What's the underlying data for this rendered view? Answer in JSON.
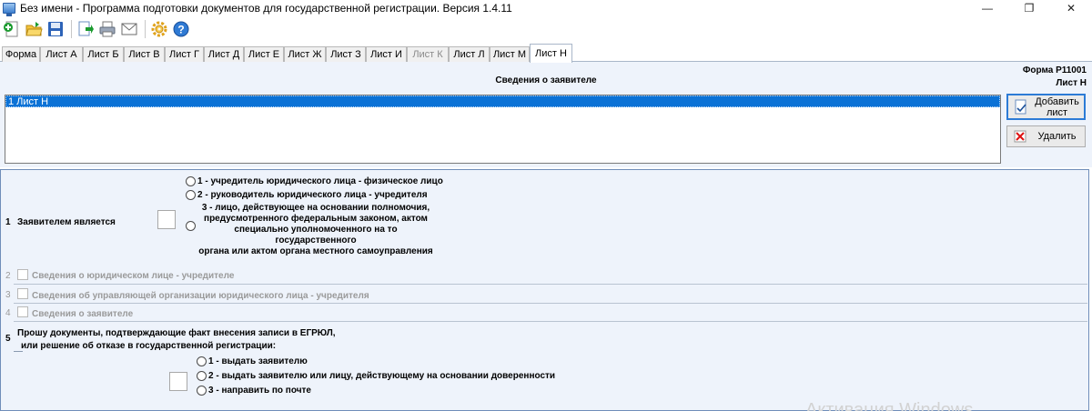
{
  "window": {
    "title": "Без имени - Программа подготовки документов для государственной регистрации. Версия 1.4.11",
    "minimize": "—",
    "maximize": "❐",
    "close": "✕"
  },
  "toolbar": {
    "icons": [
      "new-doc-icon",
      "open-folder-icon",
      "save-disk-icon",
      "export-icon",
      "print-icon",
      "mail-icon",
      "settings-gear-icon",
      "help-icon"
    ]
  },
  "tabs": [
    {
      "label": "Форма",
      "state": "normal"
    },
    {
      "label": "Лист А",
      "state": "normal"
    },
    {
      "label": "Лист Б",
      "state": "normal"
    },
    {
      "label": "Лист В",
      "state": "normal"
    },
    {
      "label": "Лист Г",
      "state": "normal"
    },
    {
      "label": "Лист Д",
      "state": "normal"
    },
    {
      "label": "Лист Е",
      "state": "normal"
    },
    {
      "label": "Лист Ж",
      "state": "normal"
    },
    {
      "label": "Лист З",
      "state": "normal"
    },
    {
      "label": "Лист И",
      "state": "normal"
    },
    {
      "label": "Лист К",
      "state": "disabled"
    },
    {
      "label": "Лист Л",
      "state": "normal"
    },
    {
      "label": "Лист М",
      "state": "normal"
    },
    {
      "label": "Лист Н",
      "state": "active"
    }
  ],
  "form": {
    "form_name": "Форма Р11001",
    "sheet_name": "Лист Н",
    "section_title": "Сведения о заявителе",
    "list_items": [
      "1 Лист Н"
    ],
    "add_button": "Добавить лист",
    "delete_button": "Удалить"
  },
  "section1": {
    "number": "1",
    "label": "Заявителем является",
    "opt1": "1 - учредитель юридического лица - физическое лицо",
    "opt2": "2 - руководитель юридического лица - учредителя",
    "opt3_line1": "3 - лицо, действующее на основании полномочия,",
    "opt3_line2": "предусмотренного федеральным законом, актом",
    "opt3_line3": "специально уполномоченного на то государственного",
    "opt3_line4": "органа или актом органа местного самоуправления"
  },
  "section2": {
    "number": "2",
    "label": "Сведения о юридическом лице - учредителе"
  },
  "section3": {
    "number": "3",
    "label": "Сведения об управляющей организации юридического лица - учредителя"
  },
  "section4": {
    "number": "4",
    "label": "Сведения о заявителе"
  },
  "section5": {
    "number": "5",
    "label_line1": "Прошу документы, подтверждающие факт внесения записи в ЕГРЮЛ,",
    "label_line2": "или решение об отказе в государственной регистрации:",
    "opt1": "1 - выдать заявителю",
    "opt2": "2 - выдать заявителю или лицу, действующему на основании доверенности",
    "opt3": "3 - направить по почте"
  },
  "watermark": "Активация Windows"
}
